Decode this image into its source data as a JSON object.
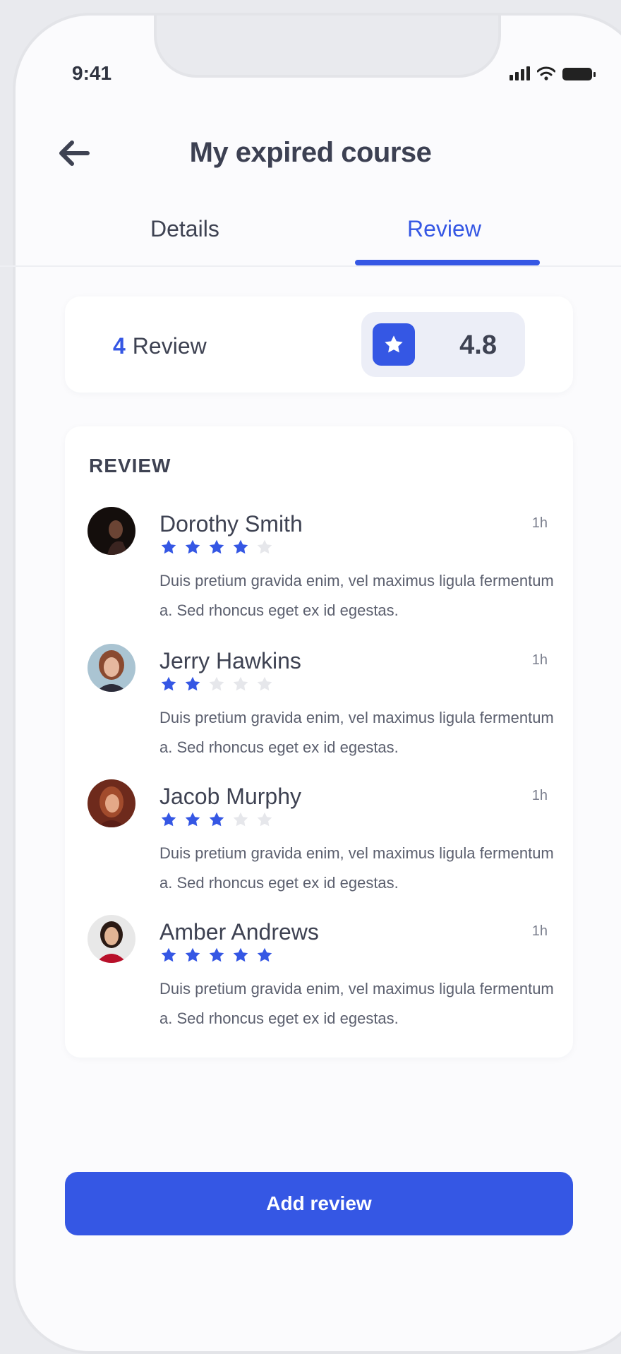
{
  "status_bar": {
    "time": "9:41"
  },
  "header": {
    "title": "My expired course"
  },
  "tabs": [
    {
      "label": "Details"
    },
    {
      "label": "Review"
    }
  ],
  "summary": {
    "count": "4",
    "count_label": "Review",
    "rating": "4.8"
  },
  "reviews_section": {
    "title": "REVIEW",
    "items": [
      {
        "name": "Dorothy Smith",
        "time": "1h",
        "rating": 4,
        "text": "Duis pretium gravida enim, vel maximus ligula fermentum a. Sed rhoncus eget ex id egestas."
      },
      {
        "name": "Jerry Hawkins",
        "time": "1h",
        "rating": 2,
        "text": "Duis pretium gravida enim, vel maximus ligula fermentum a. Sed rhoncus eget ex id egestas."
      },
      {
        "name": "Jacob Murphy",
        "time": "1h",
        "rating": 3,
        "text": "Duis pretium gravida enim, vel maximus ligula fermentum a. Sed rhoncus eget ex id egestas."
      },
      {
        "name": "Amber Andrews",
        "time": "1h",
        "rating": 5,
        "text": "Duis pretium gravida enim, vel maximus ligula fermentum a. Sed rhoncus eget ex id egestas."
      }
    ]
  },
  "actions": {
    "add_review": "Add review"
  },
  "colors": {
    "accent": "#3557e4",
    "star_empty": "#e6e7eb",
    "text": "#3e4252"
  }
}
